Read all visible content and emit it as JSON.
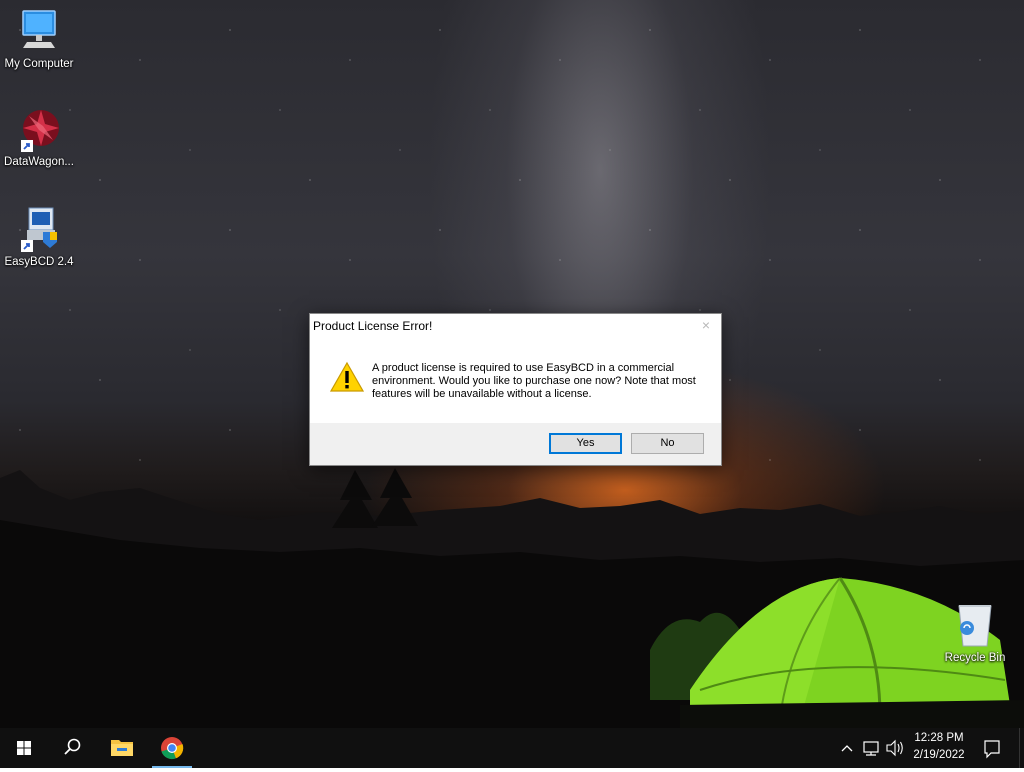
{
  "desktop": {
    "icons": [
      {
        "label": "My Computer"
      },
      {
        "label": "DataWagon..."
      },
      {
        "label": "EasyBCD 2.4"
      },
      {
        "label": "Recycle Bin"
      }
    ]
  },
  "dialog": {
    "title": "Product License Error!",
    "close_symbol": "×",
    "icon": "warning-icon",
    "message": "A product license is required to use EasyBCD in a commercial environment. Would you like to purchase one now? Note that most features will be unavailable without a license.",
    "yes_label": "Yes",
    "no_label": "No"
  },
  "taskbar": {
    "pinned": [
      "start-icon",
      "search-icon",
      "file-explorer-icon",
      "chrome-icon"
    ],
    "tray_icons": [
      "chevron-up-icon",
      "network-icon",
      "volume-icon"
    ],
    "time": "12:28 PM",
    "date": "2/19/2022",
    "notification_icon": "action-center-icon"
  },
  "colors": {
    "accent": "#0078d7",
    "taskbar": "#101010",
    "tent": "#7ed321"
  }
}
